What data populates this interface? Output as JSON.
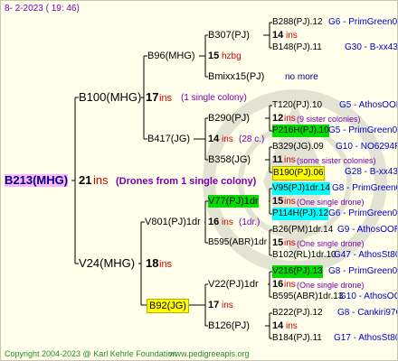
{
  "header": {
    "date": "8-  2-2023  ( 19:  46)"
  },
  "root": {
    "label": "B213(MHG)",
    "num": "21",
    "ins": "ins",
    "note": "(Drones from 1 single colony)"
  },
  "sire": {
    "label": "B100(MHG)",
    "num": "17",
    "ins": "ins",
    "note": "(1 single colony)"
  },
  "dam": {
    "label": "V24(MHG)",
    "num": "18",
    "ins": "ins"
  },
  "ss": {
    "label": "B96(MHG)",
    "num": "15",
    "ins": "hzbg"
  },
  "sd": {
    "label": "B417(JG)",
    "num": "14",
    "ins": "ins",
    "note": "(28 c.)"
  },
  "ds": {
    "label": "V801(PJ)1dr",
    "num": "16",
    "ins": "ins",
    "note": "(1dr.)"
  },
  "dd": {
    "label": "B92(JG)",
    "num": "17",
    "ins": "ins"
  },
  "g3": [
    {
      "label": "B307(PJ)",
      "num": "14",
      "ins": "ins"
    },
    {
      "label": "Bmixx15(PJ)",
      "note": "no more"
    },
    {
      "label": "B290(PJ)",
      "num": "12",
      "ins": "ins",
      "note": "(9 sister colonies)"
    },
    {
      "label": "B358(JG)",
      "num": "11",
      "ins": "ins",
      "note": "(some sister colonies)"
    },
    {
      "label": "V77(PJ)1dr",
      "num": "15",
      "ins": "ins",
      "note": "(One single drone)"
    },
    {
      "label": "B595(ABR)1dr",
      "num": "15",
      "ins": "ins",
      "note": "(One single drone)"
    },
    {
      "label": "V22(PJ)1dr",
      "num": "16",
      "ins": "ins",
      "note": "(One single drone)"
    },
    {
      "label": "B126(PJ)",
      "num": "14",
      "ins": "ins"
    }
  ],
  "g4": [
    {
      "left": "B288(PJ).12",
      "right": "G6 - PrimGreen00"
    },
    {
      "left": "B148(PJ).11",
      "right": "G30 - B-xx43"
    },
    {
      "left": "T120(PJ).10",
      "right": "G5 - AthosOOR"
    },
    {
      "left": "P216H(PJ).10",
      "right": "G5 - PrimGreen00"
    },
    {
      "left": "B329(JG).09",
      "right": "G10 - NO6294R"
    },
    {
      "left": "B190(PJ).06",
      "right": "G28 - B-xx43"
    },
    {
      "left": "V95(PJ)1dr.14",
      "right": "G8 - PrimGreen00"
    },
    {
      "left": "P114H(PJ).12",
      "right": "G6 - PrimGreen00"
    },
    {
      "left": "B26(PM)1dr.14",
      "right": "G9 - AthosOOR"
    },
    {
      "left": "B102(RL)1dr.10",
      "right": "G47 - AthosSt80R"
    },
    {
      "left": "V216(PJ).13",
      "right": "G8 - PrimGreen00"
    },
    {
      "left": "B595(ABR)1dr.13",
      "right": "G10 - AthosOOR"
    },
    {
      "left": "B222(PJ).12",
      "right": "G8 - Cankiri97Q"
    },
    {
      "left": "B184(PJ).11",
      "right": "G17 - AthosSt80R"
    }
  ],
  "footer": {
    "copyright": "Copyright 2004-2023 @ Karl Kehrle Foundation",
    "site": "www.pedigreeapis.org"
  },
  "colors": {
    "ins": "#d00000",
    "note": "#7a00b0",
    "blue": "#0000c8",
    "root_bg": "#ffb6ff",
    "footer_green": "#2a8a2a"
  }
}
